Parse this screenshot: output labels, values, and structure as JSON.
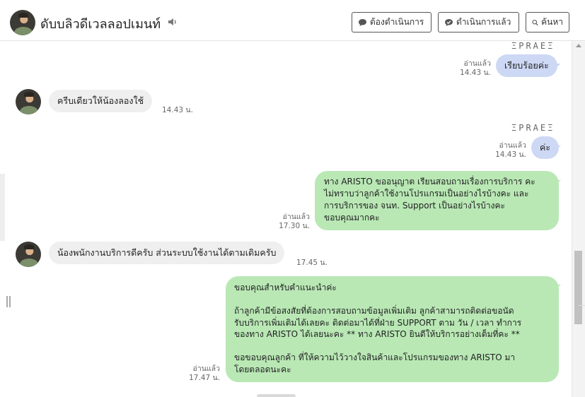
{
  "header": {
    "title": "ดับบลิวดีเวลลอปเมนท์",
    "buttons": {
      "need_action": "ต้องดำเนินการ",
      "done": "ดำเนินการแล้ว",
      "search": "ค้นหา"
    }
  },
  "icons": {
    "speaker": "speaker-icon",
    "need_action": "speech-bubble-icon",
    "done": "check-bubble-icon",
    "search": "search-icon"
  },
  "colors": {
    "incoming_bubble": "#efefef",
    "outgoing_blue": "#cdd8f5",
    "outgoing_green": "#b9e8b5"
  },
  "messages": [
    {
      "dir": "out",
      "sender": "ΞPRAEΞ",
      "text": "เรียบร้อยค่ะ",
      "read": "อ่านแล้ว",
      "time": "14.43 น."
    },
    {
      "dir": "in",
      "text": "ครีบเดียวให้น้องลองใช้",
      "time": "14.43 น."
    },
    {
      "dir": "out",
      "sender": "ΞPRAEΞ",
      "text": "ค่ะ",
      "read": "อ่านแล้ว",
      "time": "14.43 น."
    },
    {
      "dir": "out",
      "text": "ทาง ARISTO ขออนุญาต เรียนสอบถามเรื่องการบริการ คะ\nไม่ทราบว่าลูกค้าใช้งานโปรแกรมเป็นอย่างไรบ้างคะ และ\nการบริการของ จนท. Support เป็นอย่างไรบ้างคะ\nขอบคุณมากคะ",
      "read": "อ่านแล้ว",
      "time": "17.30 น."
    },
    {
      "dir": "in",
      "text": "น้องพนักงานบริการดีครับ ส่วนระบบใช้งานได้ตามเดิมครับ",
      "time": "17.45 น."
    },
    {
      "dir": "out",
      "text": "ขอบคุณสำหรับคำแนะนำค่ะ\n\nถ้าลูกค้ามีข้อสงสัยที่ต้องการสอบถามข้อมูลเพิ่มเติม ลูกค้าสามารถติดต่อขอนัด\nรับบริการเพิ่มเติมได้เลยคะ ติดต่อมาได้ที่ฝ่าย SUPPORT ตาม วัน / เวลา ทำการ\nของทาง ARISTO ได้เลยนะคะ ** ทาง ARISTO ยินดีให้บริการอย่างเต็มที่คะ **\n\nขอขอบคุณลูกค้า ที่ให้ความไว้วางใจสินค้าและโปรแกรมของทาง ARISTO มา\nโดยตลอดนะคะ",
      "read": "อ่านแล้ว",
      "time": "17.47 น."
    }
  ]
}
